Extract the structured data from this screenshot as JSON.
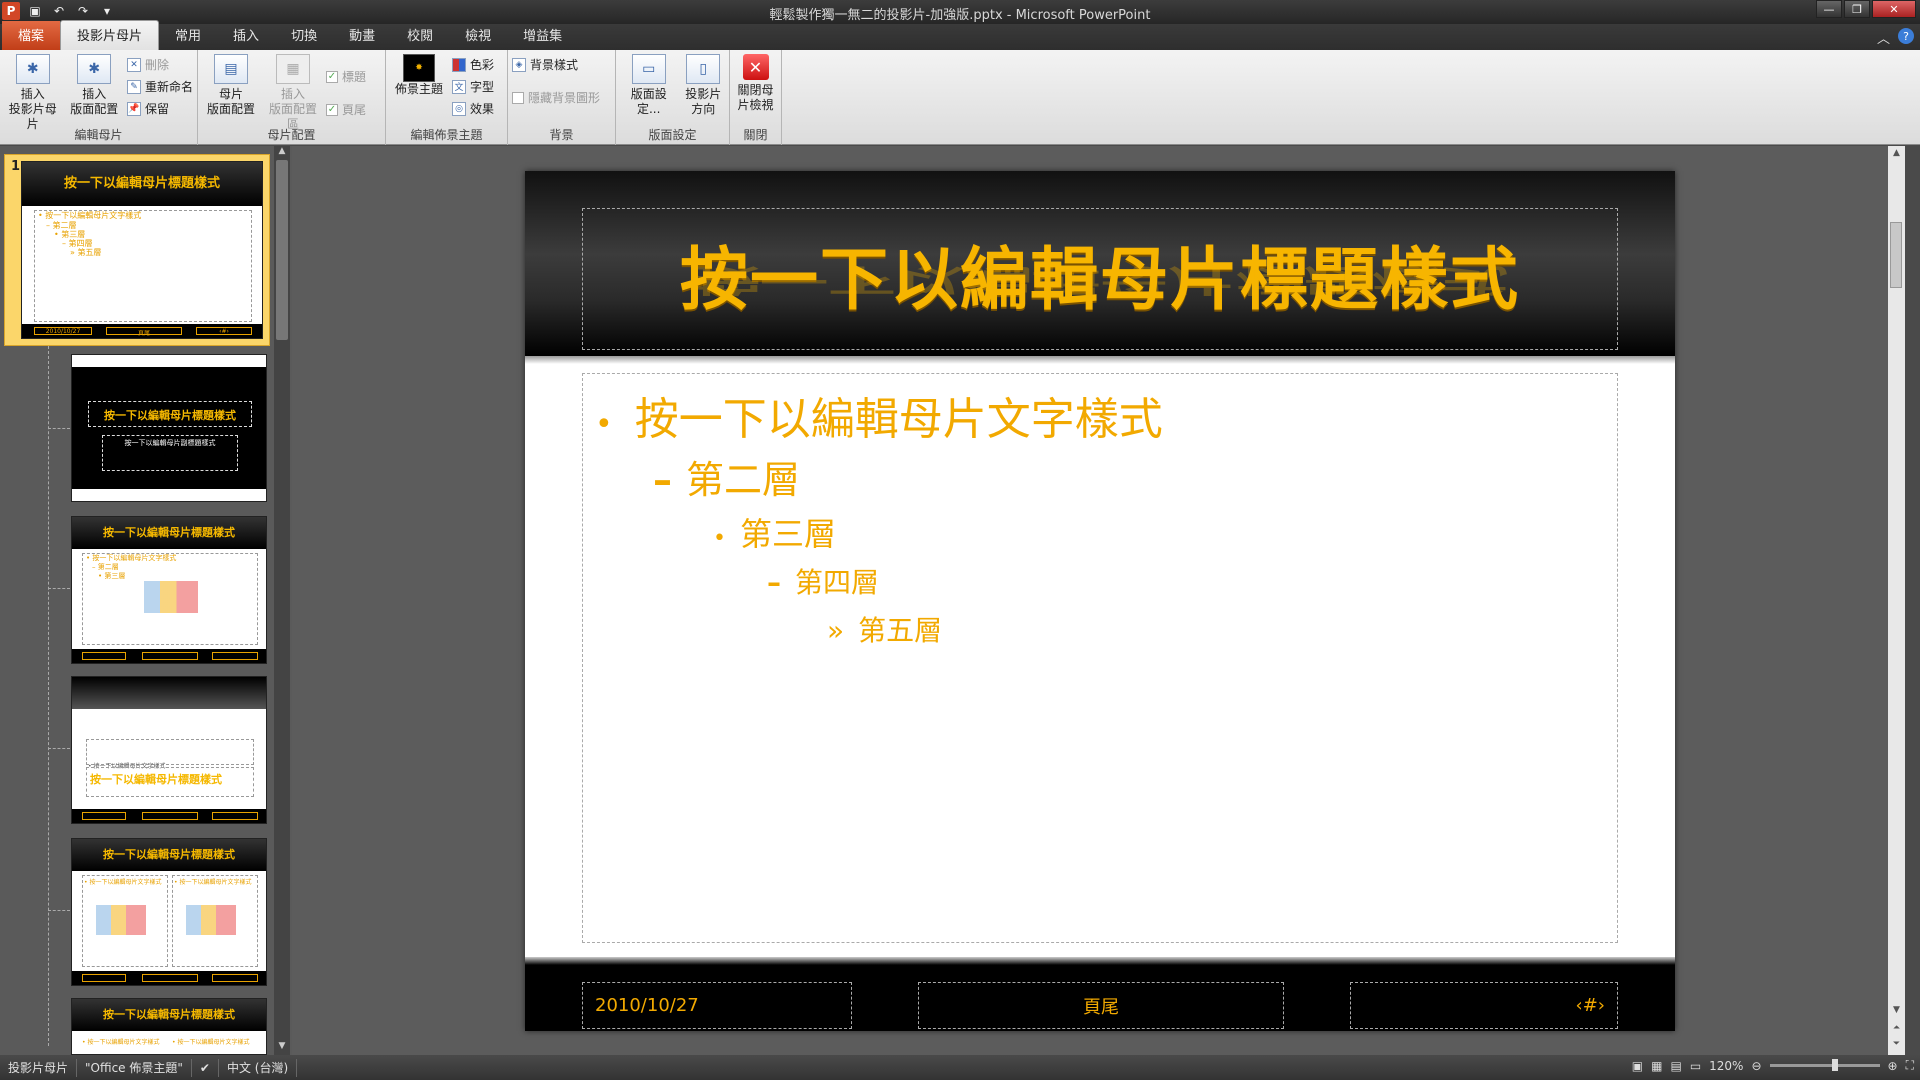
{
  "titlebar": {
    "title": "輕鬆製作獨一無二的投影片-加強版.pptx - Microsoft PowerPoint",
    "qat_icons": [
      "powerpoint-logo",
      "save-icon",
      "undo-icon",
      "redo-icon",
      "customize-icon"
    ]
  },
  "tabs": [
    {
      "label": "檔案"
    },
    {
      "label": "投影片母片"
    },
    {
      "label": "常用"
    },
    {
      "label": "插入"
    },
    {
      "label": "切換"
    },
    {
      "label": "動畫"
    },
    {
      "label": "校閱"
    },
    {
      "label": "檢視"
    },
    {
      "label": "增益集"
    }
  ],
  "ribbon": {
    "edit_master": {
      "label": "編輯母片",
      "insert_master": "插入\n投影片母片",
      "insert_layout": "插入\n版面配置",
      "delete": "刪除",
      "rename": "重新命名",
      "preserve": "保留"
    },
    "master_layout": {
      "label": "母片配置",
      "master_layout_btn": "母片\n版面配置",
      "insert_placeholder": "插入\n版面配置區",
      "title_chk": "標題",
      "footer_chk": "頁尾"
    },
    "edit_theme": {
      "label": "編輯佈景主題",
      "themes": "佈景主題",
      "colors": "色彩",
      "fonts": "字型",
      "effects": "效果"
    },
    "background": {
      "label": "背景",
      "styles": "背景樣式",
      "hide_graphics": "隱藏背景圖形"
    },
    "page_setup": {
      "label": "版面設定",
      "setup": "版面設定...",
      "orientation": "投影片\n方向"
    },
    "close": {
      "label": "關閉",
      "close_master": "關閉母\n片檢視"
    }
  },
  "thumbnails": {
    "master_number": "1",
    "title": "按一下以編輯母片標題樣式",
    "subtitle": "按一下以編輯母片副標題樣式",
    "body_lines": [
      "• 按一下以編輯母片文字樣式",
      "– 第二層",
      "• 第三層",
      "– 第四層",
      "» 第五層"
    ],
    "footer": [
      "2010/10/27",
      "頁尾",
      "‹#›"
    ]
  },
  "slide": {
    "title": "按一下以編輯母片標題樣式",
    "levels": [
      {
        "bullet": "•",
        "text": "按一下以編輯母片文字樣式"
      },
      {
        "bullet": "–",
        "text": "第二層"
      },
      {
        "bullet": "•",
        "text": "第三層"
      },
      {
        "bullet": "–",
        "text": "第四層"
      },
      {
        "bullet": "»",
        "text": "第五層"
      }
    ],
    "footer_date": "2010/10/27",
    "footer_text": "頁尾",
    "footer_number": "‹#›"
  },
  "statusbar": {
    "view": "投影片母片",
    "theme": "\"Office 佈景主題\"",
    "language": "中文 (台灣)",
    "zoom": "120%"
  },
  "colors": {
    "accent_gold": "#f2a900",
    "file_tab": "#c13e18"
  }
}
